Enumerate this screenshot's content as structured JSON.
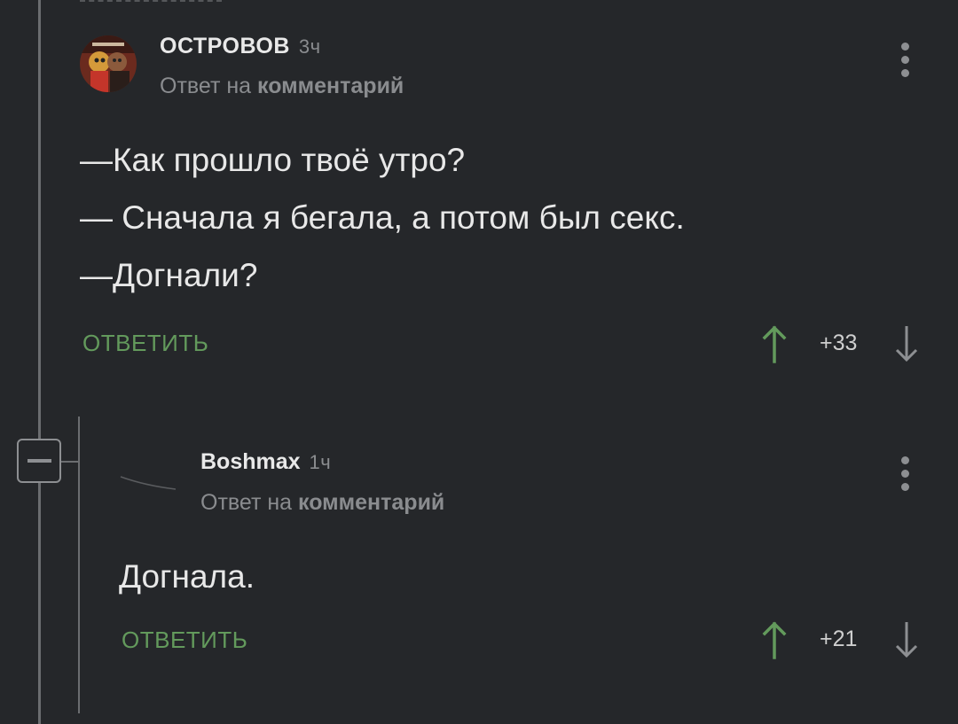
{
  "comments": [
    {
      "author": "ОСТРОВОВ",
      "time": "3ч",
      "reply_prefix": "Ответ на",
      "reply_target": "комментарий",
      "lines": [
        "—Как прошло твоё утро?",
        "— Сначала я бегала, а потом был секс.",
        "—Догнали?"
      ],
      "reply_label": "ОТВЕТИТЬ",
      "score": "+33"
    },
    {
      "author": "Boshmax",
      "time": "1ч",
      "reply_prefix": "Ответ на",
      "reply_target": "комментарий",
      "lines": [
        "Догнала."
      ],
      "reply_label": "ОТВЕТИТЬ",
      "score": "+21"
    }
  ],
  "colors": {
    "background": "#25272a",
    "accent_green": "#639a5c",
    "muted": "#8a8c8f",
    "thread_line": "#6b6d70"
  },
  "icons": [
    "avatar",
    "more-vertical-icon",
    "upvote-arrow-icon",
    "downvote-arrow-icon",
    "collapse-icon"
  ]
}
